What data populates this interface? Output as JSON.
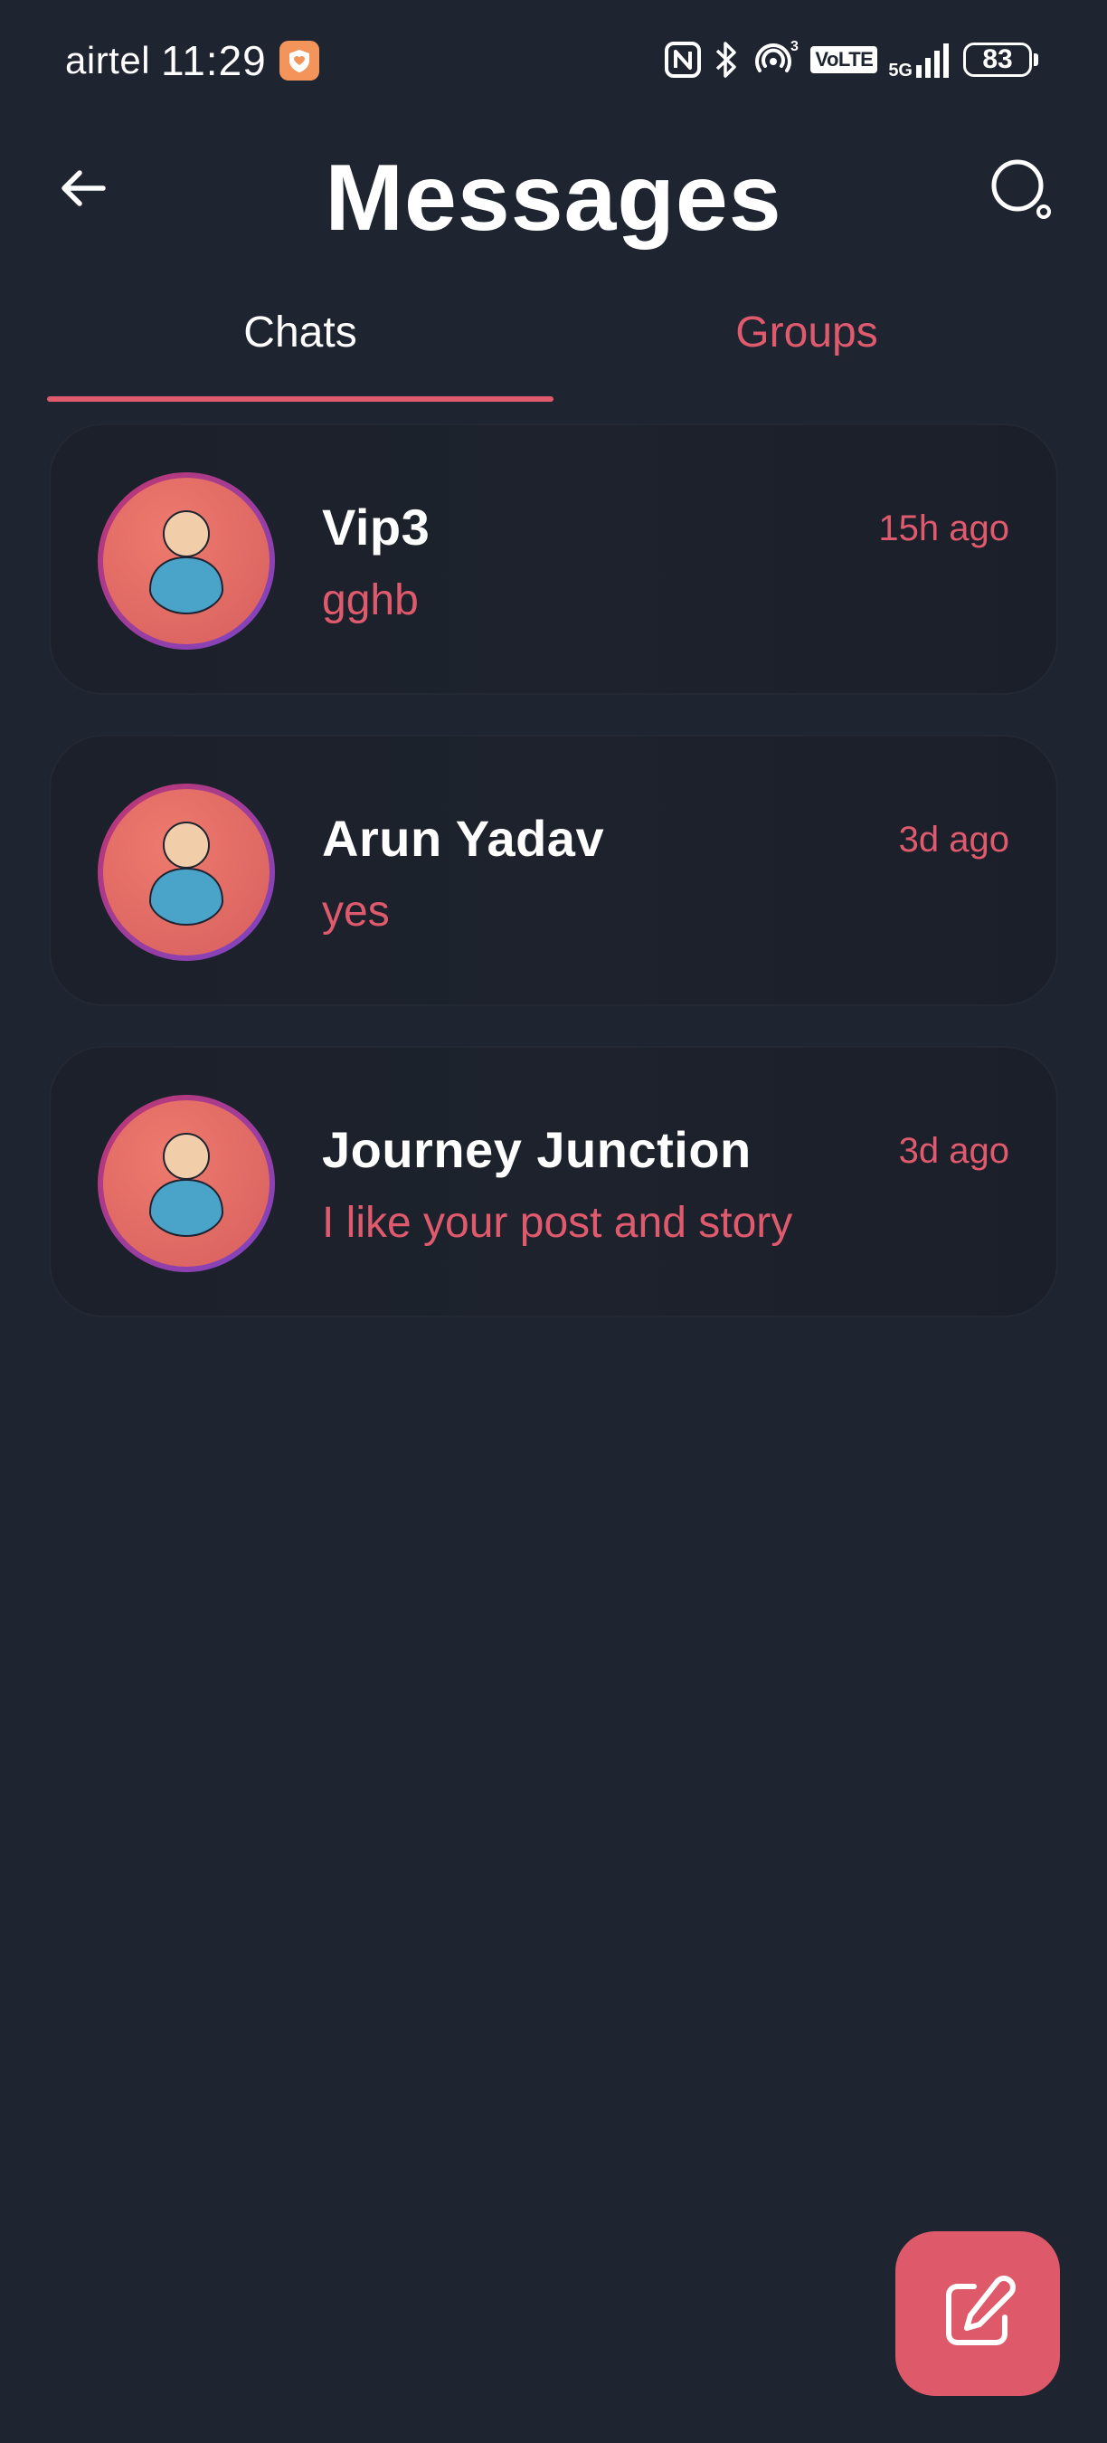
{
  "status_bar": {
    "carrier": "airtel",
    "time": "11:29",
    "app_notification_icon": "heart-shield-icon",
    "network_label": "VoLTE",
    "network_5g": "5G",
    "signal_superscript": "3",
    "battery_level": "83",
    "colors": {
      "app_icon_bg": "#f3945a"
    }
  },
  "header": {
    "title": "Messages",
    "back_icon": "arrow-left-icon",
    "search_icon": "search-icon"
  },
  "tabs": [
    {
      "label": "Chats",
      "active": true
    },
    {
      "label": "Groups",
      "active": false
    }
  ],
  "chats": [
    {
      "name": "Vip3",
      "last_message": "gghb",
      "time": "15h ago",
      "avatar": "default-user-avatar"
    },
    {
      "name": "Arun Yadav",
      "last_message": "yes",
      "time": "3d ago",
      "avatar": "default-user-avatar"
    },
    {
      "name": "Journey Junction",
      "last_message": "I like your post and story",
      "time": "3d ago",
      "avatar": "default-user-avatar"
    }
  ],
  "fab": {
    "icon": "compose-icon"
  },
  "theme": {
    "background": "#1e2430",
    "accent": "#e05a6e",
    "text_primary": "#ffffff",
    "avatar_ring_start": "#c2366e",
    "avatar_ring_end": "#7b44c7",
    "avatar_bg": "#e06a64",
    "avatar_head": "#f2cda9",
    "avatar_body": "#4aa3c9"
  }
}
